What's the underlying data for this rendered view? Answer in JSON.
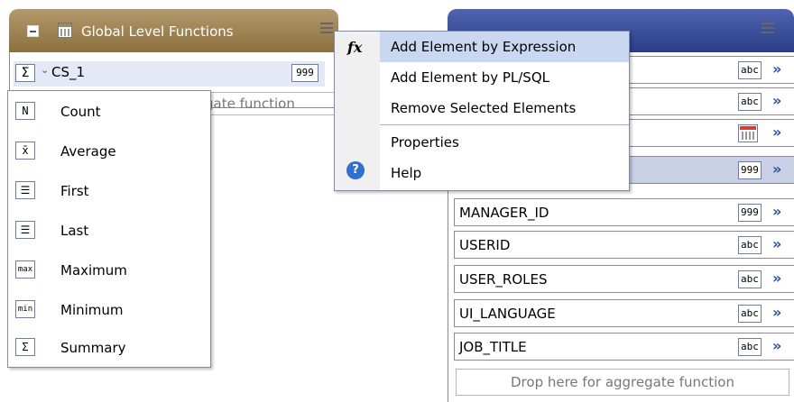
{
  "global_panel": {
    "title": "Global Level Functions",
    "column": {
      "name": "CS_1",
      "type_tag": "999"
    },
    "drop_text": "gate function"
  },
  "aggregate_menu": [
    {
      "icon": "N",
      "label": "Count"
    },
    {
      "icon": "x̄",
      "label": "Average"
    },
    {
      "icon": "☰",
      "label": "First"
    },
    {
      "icon": "☰",
      "label": "Last"
    },
    {
      "icon": "max",
      "label": "Maximum"
    },
    {
      "icon": "min",
      "label": "Minimum"
    },
    {
      "icon": "Σ",
      "label": "Summary"
    }
  ],
  "context_menu": [
    {
      "label": "Add Element by Expression",
      "icon": "fx-icon"
    },
    {
      "label": "Add Element by PL/SQL"
    },
    {
      "label": "Remove Selected Elements"
    },
    {
      "label": "Properties"
    },
    {
      "label": "Help",
      "icon": "help-icon"
    }
  ],
  "right_panel": {
    "rows": [
      {
        "label": "",
        "tag": "abc"
      },
      {
        "label": "",
        "tag": "abc"
      },
      {
        "label": "",
        "tag": "date"
      },
      {
        "label": "",
        "tag": "999"
      },
      {
        "label": "MANAGER_ID",
        "tag": "999"
      },
      {
        "label": "USERID",
        "tag": "abc"
      },
      {
        "label": "USER_ROLES",
        "tag": "abc"
      },
      {
        "label": "UI_LANGUAGE",
        "tag": "abc"
      },
      {
        "label": "JOB_TITLE",
        "tag": "abc"
      }
    ],
    "drop_text": "Drop here for aggregate function"
  },
  "colors": {
    "left_header": "#9c8355",
    "right_header": "#3a4d9a",
    "selection": "#c9d0e6",
    "menu_highlight": "#c9d8f0",
    "chevron": "#2c4ea0"
  }
}
